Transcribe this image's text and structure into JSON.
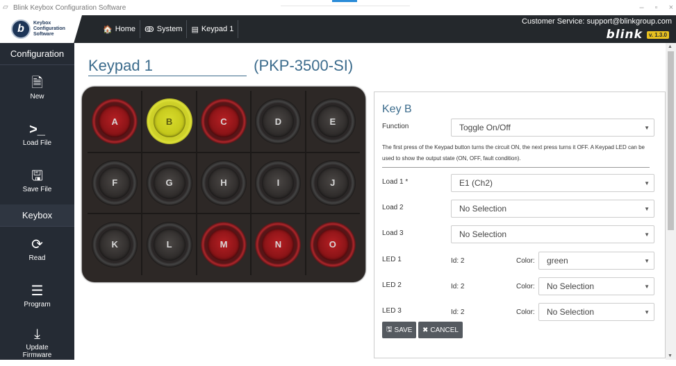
{
  "window": {
    "title": "Blink Keybox Configuration Software",
    "controls": [
      "–",
      "▫",
      "×"
    ]
  },
  "header": {
    "logo": {
      "initial": "b",
      "lines": [
        "Keybox",
        "Configuration",
        "Software"
      ]
    },
    "nav": [
      {
        "icon": "home-icon",
        "glyph": "🏠",
        "label": "Home"
      },
      {
        "icon": "system-icon",
        "glyph": "ↂ",
        "label": "System"
      },
      {
        "icon": "keypad-icon",
        "glyph": "▤",
        "label": "Keypad 1"
      }
    ],
    "customer_service": "Customer Service: support@blinkgroup.com",
    "brand": "blink",
    "version": "v. 1.3.0"
  },
  "sidebar": {
    "configuration_header": "Configuration",
    "configuration_items": [
      {
        "icon": "file-icon",
        "glyph": "🗎",
        "label": "New"
      },
      {
        "icon": "terminal-icon",
        "glyph": ">_",
        "label": "Load File"
      },
      {
        "icon": "save-icon",
        "glyph": "🖫",
        "label": "Save File"
      }
    ],
    "keybox_header": "Keybox",
    "keybox_items": [
      {
        "icon": "refresh-icon",
        "glyph": "⟳",
        "label": "Read"
      },
      {
        "icon": "sliders-icon",
        "glyph": "☰",
        "label": "Program"
      },
      {
        "icon": "download-icon",
        "glyph": "⤓",
        "label": "Update Firmware"
      }
    ]
  },
  "page": {
    "title": "Keypad 1",
    "model": "(PKP-3500-SI)"
  },
  "keypad": {
    "keys": [
      {
        "label": "A",
        "state": "red"
      },
      {
        "label": "B",
        "state": "yellow"
      },
      {
        "label": "C",
        "state": "red"
      },
      {
        "label": "D",
        "state": "off"
      },
      {
        "label": "E",
        "state": "off"
      },
      {
        "label": "F",
        "state": "off"
      },
      {
        "label": "G",
        "state": "off"
      },
      {
        "label": "H",
        "state": "off"
      },
      {
        "label": "I",
        "state": "off"
      },
      {
        "label": "J",
        "state": "off"
      },
      {
        "label": "K",
        "state": "off"
      },
      {
        "label": "L",
        "state": "off"
      },
      {
        "label": "M",
        "state": "red"
      },
      {
        "label": "N",
        "state": "red"
      },
      {
        "label": "O",
        "state": "red"
      }
    ]
  },
  "key_panel": {
    "title": "Key B",
    "function_label": "Function",
    "function_value": "Toggle On/Off",
    "description": "The first press of the Keypad button turns the circuit ON, the next press turns it OFF. A Keypad LED can be used to show the output state (ON, OFF, fault condition).",
    "loads": [
      {
        "label": "Load 1 *",
        "value": "E1 (Ch2)"
      },
      {
        "label": "Load 2",
        "value": "No Selection"
      },
      {
        "label": "Load 3",
        "value": "No Selection"
      }
    ],
    "leds": [
      {
        "label": "LED 1",
        "id": "Id: 2",
        "color_label": "Color:",
        "color_value": "green"
      },
      {
        "label": "LED 2",
        "id": "Id: 2",
        "color_label": "Color:",
        "color_value": "No Selection"
      },
      {
        "label": "LED 3",
        "id": "Id: 2",
        "color_label": "Color:",
        "color_value": "No Selection"
      }
    ],
    "save_label": "SAVE",
    "cancel_label": "CANCEL"
  },
  "colors": {
    "sidebar_bg": "#252b34",
    "topbar_bg": "#24282c",
    "title_blue": "#3b6b8c",
    "key_red": "#b51f23",
    "key_yellow": "#d8db2c",
    "version_badge": "#e8c120"
  }
}
